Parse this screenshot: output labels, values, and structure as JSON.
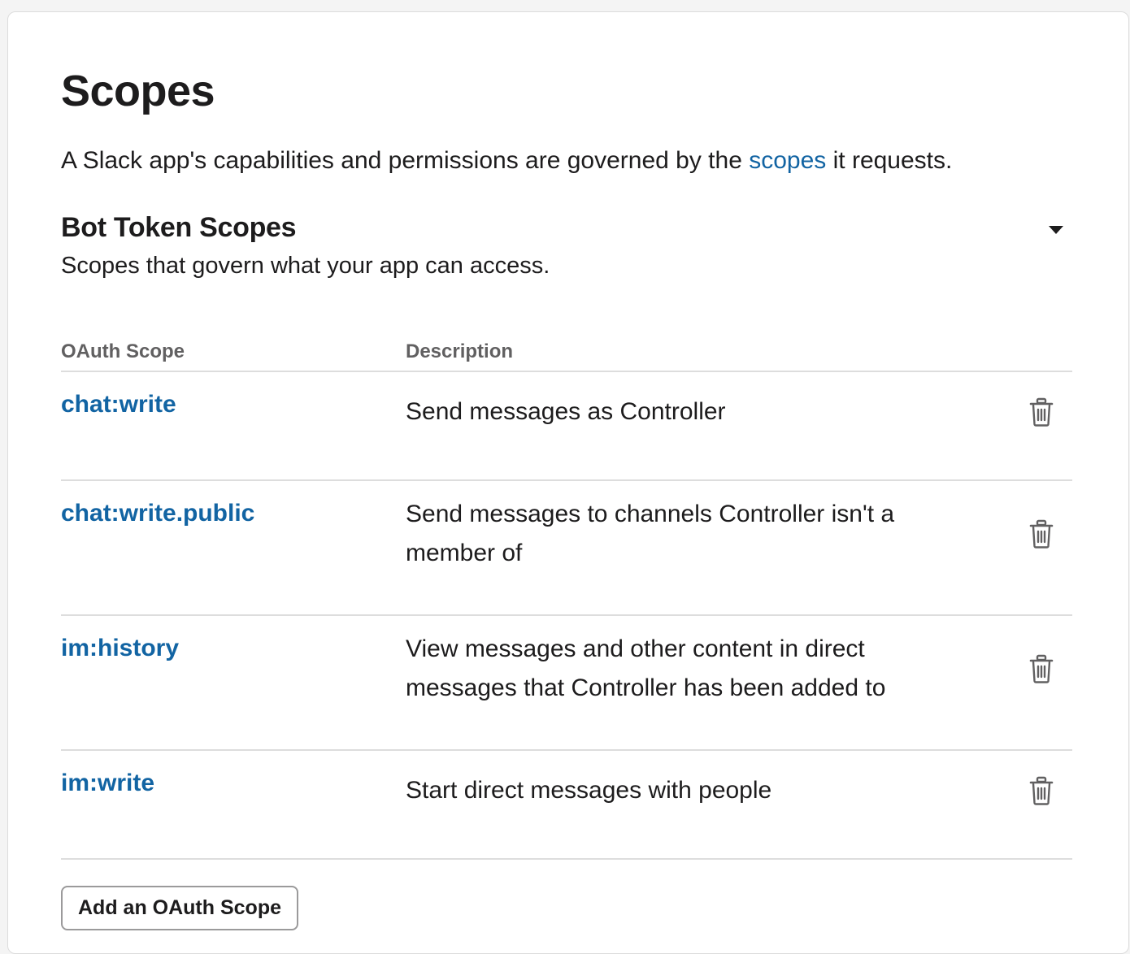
{
  "page": {
    "title": "Scopes",
    "intro_before": "A Slack app's capabilities and permissions are governed by the ",
    "intro_link": "scopes",
    "intro_after": " it requests."
  },
  "bot_scopes": {
    "title": "Bot Token Scopes",
    "subtitle": "Scopes that govern what your app can access.",
    "toggle_icon": "caret-down-icon",
    "columns": {
      "scope": "OAuth Scope",
      "description": "Description"
    },
    "rows": [
      {
        "scope": "chat:write",
        "description": "Send messages as Controller",
        "icon": "trash-icon"
      },
      {
        "scope": "chat:write.public",
        "description": "Send messages to channels Controller isn't a member of",
        "icon": "trash-icon"
      },
      {
        "scope": "im:history",
        "description": "View messages and other content in direct messages that Controller has been added to",
        "icon": "trash-icon"
      },
      {
        "scope": "im:write",
        "description": "Start direct messages with people",
        "icon": "trash-icon"
      }
    ],
    "add_button_label": "Add an OAuth Scope"
  },
  "colors": {
    "link": "#1264a3",
    "text": "#1d1c1d",
    "muted": "#616061",
    "divider": "#dddddd"
  }
}
